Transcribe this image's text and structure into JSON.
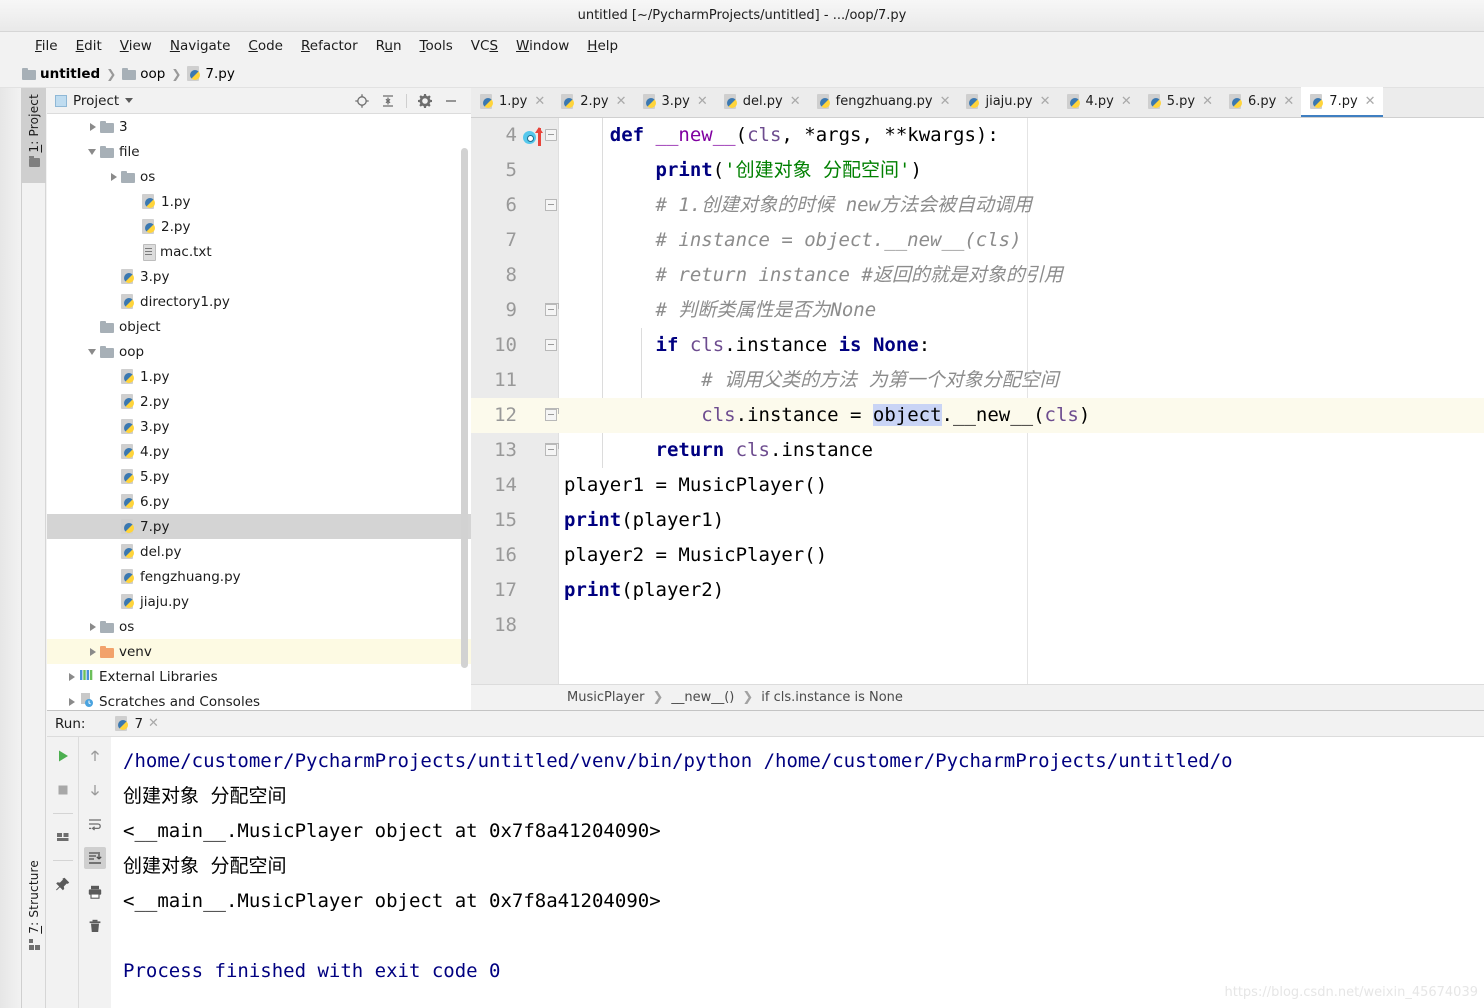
{
  "window": {
    "title": "untitled [~/PycharmProjects/untitled] - .../oop/7.py"
  },
  "menubar": {
    "items": [
      {
        "label": "File",
        "mnemonic": "F"
      },
      {
        "label": "Edit",
        "mnemonic": "E"
      },
      {
        "label": "View",
        "mnemonic": "V"
      },
      {
        "label": "Navigate",
        "mnemonic": "N"
      },
      {
        "label": "Code",
        "mnemonic": "C"
      },
      {
        "label": "Refactor",
        "mnemonic": "R"
      },
      {
        "label": "Run",
        "mnemonic": "u"
      },
      {
        "label": "Tools",
        "mnemonic": "T"
      },
      {
        "label": "VCS",
        "mnemonic": "S"
      },
      {
        "label": "Window",
        "mnemonic": "W"
      },
      {
        "label": "Help",
        "mnemonic": "H"
      }
    ]
  },
  "navbar": {
    "crumbs": [
      {
        "label": "untitled",
        "icon": "folder-icon"
      },
      {
        "label": "oop",
        "icon": "folder-icon"
      },
      {
        "label": "7.py",
        "icon": "python-file-icon"
      }
    ]
  },
  "tool_tabs": {
    "project": "1: Project",
    "structure": "7: Structure"
  },
  "project_panel": {
    "title": "Project",
    "actions": [
      "locate-icon",
      "collapse-all-icon",
      "settings-gear-icon",
      "hide-icon"
    ],
    "tree": [
      {
        "label": "3",
        "type": "folder",
        "twisty": "closed",
        "indent": 1
      },
      {
        "label": "file",
        "type": "folder",
        "twisty": "open",
        "indent": 1
      },
      {
        "label": "os",
        "type": "folder",
        "twisty": "closed",
        "indent": 2
      },
      {
        "label": "1.py",
        "type": "python",
        "twisty": "none",
        "indent": 3
      },
      {
        "label": "2.py",
        "type": "python",
        "twisty": "none",
        "indent": 3
      },
      {
        "label": "mac.txt",
        "type": "text",
        "twisty": "none",
        "indent": 3
      },
      {
        "label": "3.py",
        "type": "python",
        "twisty": "none",
        "indent": 2
      },
      {
        "label": "directory1.py",
        "type": "python",
        "twisty": "none",
        "indent": 2
      },
      {
        "label": "object",
        "type": "folder",
        "twisty": "none",
        "indent": 1
      },
      {
        "label": "oop",
        "type": "folder",
        "twisty": "open",
        "indent": 1
      },
      {
        "label": "1.py",
        "type": "python",
        "twisty": "none",
        "indent": 2
      },
      {
        "label": "2.py",
        "type": "python",
        "twisty": "none",
        "indent": 2
      },
      {
        "label": "3.py",
        "type": "python",
        "twisty": "none",
        "indent": 2
      },
      {
        "label": "4.py",
        "type": "python",
        "twisty": "none",
        "indent": 2
      },
      {
        "label": "5.py",
        "type": "python",
        "twisty": "none",
        "indent": 2
      },
      {
        "label": "6.py",
        "type": "python",
        "twisty": "none",
        "indent": 2
      },
      {
        "label": "7.py",
        "type": "python",
        "twisty": "none",
        "indent": 2,
        "state": "selected"
      },
      {
        "label": "del.py",
        "type": "python",
        "twisty": "none",
        "indent": 2
      },
      {
        "label": "fengzhuang.py",
        "type": "python",
        "twisty": "none",
        "indent": 2
      },
      {
        "label": "jiaju.py",
        "type": "python",
        "twisty": "none",
        "indent": 2
      },
      {
        "label": "os",
        "type": "folder",
        "twisty": "closed",
        "indent": 1
      },
      {
        "label": "venv",
        "type": "folder-orange",
        "twisty": "closed",
        "indent": 1,
        "state": "highlighted"
      },
      {
        "label": "External Libraries",
        "type": "libraries",
        "twisty": "closed",
        "indent": 0
      },
      {
        "label": "Scratches and Consoles",
        "type": "scratches",
        "twisty": "closed",
        "indent": 0
      }
    ]
  },
  "editor_tabs": [
    {
      "label": "1.py",
      "active": false
    },
    {
      "label": "2.py",
      "active": false
    },
    {
      "label": "3.py",
      "active": false
    },
    {
      "label": "del.py",
      "active": false
    },
    {
      "label": "fengzhuang.py",
      "active": false
    },
    {
      "label": "jiaju.py",
      "active": false
    },
    {
      "label": "4.py",
      "active": false
    },
    {
      "label": "5.py",
      "active": false
    },
    {
      "label": "6.py",
      "active": false
    },
    {
      "label": "7.py",
      "active": true
    }
  ],
  "editor": {
    "first_line": 4,
    "highlighted_line": 12,
    "lines": [
      {
        "n": 4,
        "text": "    def __new__(cls, *args, **kwargs):"
      },
      {
        "n": 5,
        "text": "        print('创建对象 分配空间')"
      },
      {
        "n": 6,
        "text": "        # 1.创建对象的时候 new方法会被自动调用"
      },
      {
        "n": 7,
        "text": "        # instance = object.__new__(cls)"
      },
      {
        "n": 8,
        "text": "        # return instance #返回的就是对象的引用"
      },
      {
        "n": 9,
        "text": "        # 判断类属性是否为None"
      },
      {
        "n": 10,
        "text": "        if cls.instance is None:"
      },
      {
        "n": 11,
        "text": "            # 调用父类的方法 为第一个对象分配空间"
      },
      {
        "n": 12,
        "text": "            cls.instance = object.__new__(cls)"
      },
      {
        "n": 13,
        "text": "        return cls.instance"
      },
      {
        "n": 14,
        "text": "player1 = MusicPlayer()"
      },
      {
        "n": 15,
        "text": "print(player1)"
      },
      {
        "n": 16,
        "text": "player2 = MusicPlayer()"
      },
      {
        "n": 17,
        "text": "print(player2)"
      },
      {
        "n": 18,
        "text": ""
      }
    ],
    "selected_token": "object"
  },
  "editor_breadcrumb": [
    "MusicPlayer",
    "__new__()",
    "if cls.instance is None"
  ],
  "run_panel": {
    "label": "Run:",
    "tab_name": "7",
    "toolbar_left": [
      "rerun-icon",
      "stop-icon",
      "restore-layout-icon",
      "pin-icon"
    ],
    "toolbar_right": [
      "up-arrow-icon",
      "down-arrow-icon",
      "soft-wrap-icon",
      "scroll-to-end-icon",
      "print-icon",
      "trash-icon"
    ],
    "console_lines": [
      {
        "text": "/home/customer/PycharmProjects/untitled/venv/bin/python /home/customer/PycharmProjects/untitled/o",
        "kind": "cmd"
      },
      {
        "text": "创建对象 分配空间",
        "kind": "out"
      },
      {
        "text": "<__main__.MusicPlayer object at 0x7f8a41204090>",
        "kind": "out"
      },
      {
        "text": "创建对象 分配空间",
        "kind": "out"
      },
      {
        "text": "<__main__.MusicPlayer object at 0x7f8a41204090>",
        "kind": "out"
      },
      {
        "text": "",
        "kind": "out"
      },
      {
        "text": "Process finished with exit code 0",
        "kind": "cmd"
      }
    ]
  },
  "watermark": "https://blog.csdn.net/weixin_45674039",
  "colors": {
    "accent": "#3f7fc1",
    "keyword": "#000080",
    "string": "#008000",
    "comment": "#8c8c8c",
    "function": "#8000a0",
    "selection": "#c9d4f5",
    "line_highlight": "#fcfaec",
    "tree_selected": "#d4d4d4",
    "tree_highlight": "#fdfae3"
  }
}
